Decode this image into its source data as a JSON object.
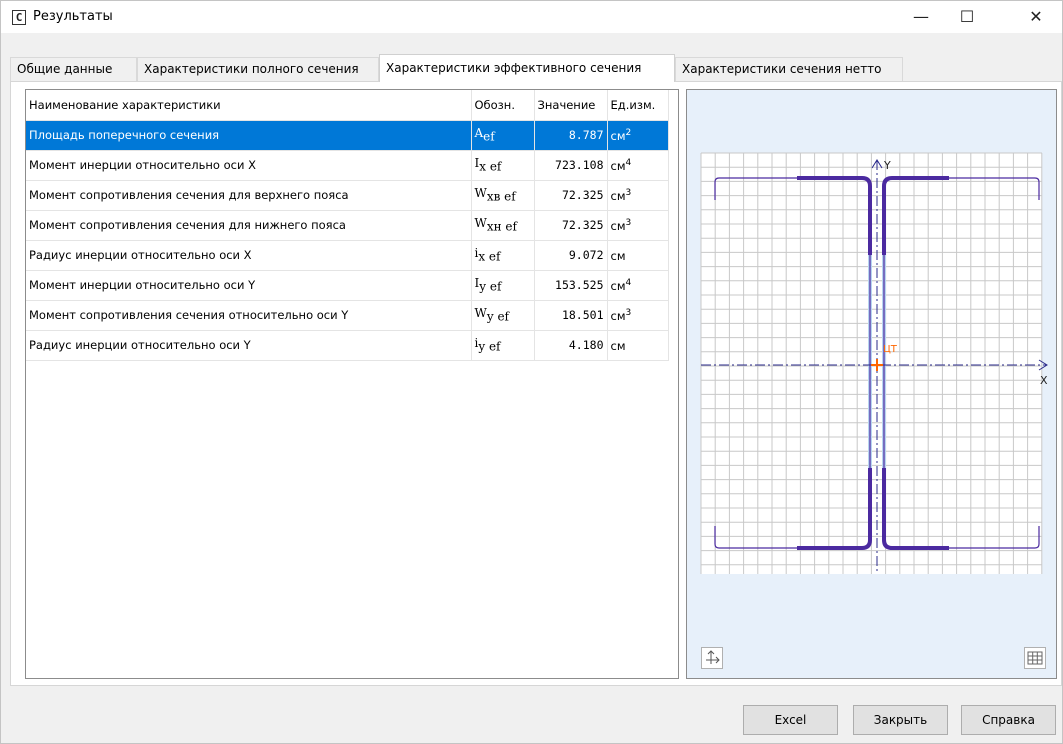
{
  "window": {
    "icon_glyph": "C",
    "title": "Результаты",
    "controls": {
      "minimize": "—",
      "maximize": "☐",
      "close": "✕"
    }
  },
  "tabs": [
    {
      "label": "Общие данные"
    },
    {
      "label": "Характеристики полного сечения"
    },
    {
      "label": "Характеристики эффективного сечения",
      "active": true
    },
    {
      "label": "Характеристики сечения нетто"
    }
  ],
  "table": {
    "columns": [
      "Наименование характеристики",
      "Обозн.",
      "Значение",
      "Ед.изм."
    ],
    "rows": [
      {
        "name": "Площадь поперечного сечения",
        "sym": "A",
        "sub": "ef",
        "value": "8.787",
        "unit": "см",
        "pow": "2",
        "selected": true
      },
      {
        "name": "Момент инерции относительно оси X",
        "sym": "I",
        "sub": "x ef",
        "value": "723.108",
        "unit": "см",
        "pow": "4"
      },
      {
        "name": "Момент сопротивления сечения для верхнего пояса",
        "sym": "W",
        "sub": "xв ef",
        "value": "72.325",
        "unit": "см",
        "pow": "3"
      },
      {
        "name": "Момент сопротивления сечения для нижнего пояса",
        "sym": "W",
        "sub": "xн ef",
        "value": "72.325",
        "unit": "см",
        "pow": "3"
      },
      {
        "name": "Радиус инерции относительно оси X",
        "sym": "i",
        "sub": "x ef",
        "value": "9.072",
        "unit": "см",
        "pow": ""
      },
      {
        "name": "Момент инерции относительно оси Y",
        "sym": "I",
        "sub": "y ef",
        "value": "153.525",
        "unit": "см",
        "pow": "4"
      },
      {
        "name": "Момент сопротивления сечения относительно оси Y",
        "sym": "W",
        "sub": "y ef",
        "value": "18.501",
        "unit": "см",
        "pow": "3"
      },
      {
        "name": "Радиус инерции относительно оси Y",
        "sym": "i",
        "sub": "y ef",
        "value": "4.180",
        "unit": "см",
        "pow": ""
      }
    ]
  },
  "viewer": {
    "axis_y_label": "Y",
    "axis_x_label": "X",
    "centroid_label": "ЦТ",
    "axes_button_icon": "axes-icon",
    "grid_button_icon": "grid-icon",
    "colors": {
      "background": "#e7f0fa",
      "grid": "#c8c8c8",
      "profile": "#4b2aa0",
      "reduced": "#b8d4f0",
      "axis": "#2a2a8a",
      "centroid": "#ff6600"
    }
  },
  "buttons": {
    "excel": "Excel",
    "close": "Закрыть",
    "help": "Справка"
  }
}
